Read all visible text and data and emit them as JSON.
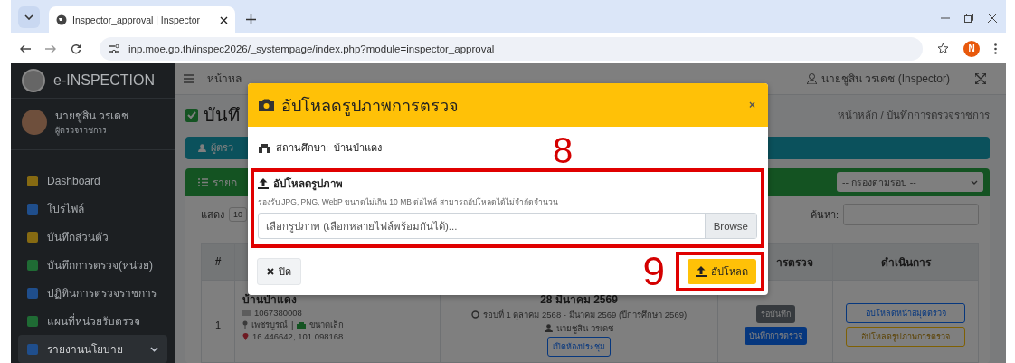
{
  "browser": {
    "tab_title": "Inspector_approval | Inspector",
    "url": "inp.moe.go.th/inspec2026/_systempage/index.php?module=inspector_approval",
    "profile_initial": "N"
  },
  "sidebar": {
    "brand": "e-INSPECTION",
    "user_name": "นายชูสิน วรเดช",
    "user_role": "ผู้ตรวจราชการ",
    "items": [
      {
        "label": "Dashboard",
        "color": "#866a12",
        "kind": "link",
        "selected": false
      },
      {
        "label": "โปรไฟล์",
        "color": "#1f4e8c",
        "kind": "link",
        "selected": false
      },
      {
        "label": "บันทึกส่วนตัว",
        "color": "#866a12",
        "kind": "link",
        "selected": false
      },
      {
        "label": "บันทึกการตรวจ(หน่วย)",
        "color": "#1f6b34",
        "kind": "link",
        "selected": false
      },
      {
        "label": "ปฏิทินการตรวจราชการ",
        "color": "#1f4e8c",
        "kind": "link",
        "selected": false
      },
      {
        "label": "แผนที่หน่วยรับตรวจ",
        "color": "#1f6b34",
        "kind": "link",
        "selected": false
      },
      {
        "label": "รายงานนโยบาย",
        "color": "#1f4e8c",
        "kind": "group",
        "selected": true
      }
    ]
  },
  "topbar": {
    "home": "หน้าหล",
    "user": "นายชูสิน วรเดช (Inspector)"
  },
  "page": {
    "title": "บันทึ",
    "breadcrumb_home": "หน้าหลัก",
    "breadcrumb_separator": "/",
    "breadcrumb_current": "บันทึกการตรวจราชการ",
    "info_bar": "ผู้ตรว",
    "list_header": "รายก",
    "filter": "-- กรองตามรอบ --",
    "show_label": "แสดง",
    "page_size": "10",
    "search_label": "ค้นหา:"
  },
  "table": {
    "columns": [
      "#",
      "ารตรวจ",
      "ดำเนินการ"
    ],
    "rows": [
      {
        "number": "1",
        "school": "บ้านป่าแดง",
        "school_code": "1067380008",
        "province": "เพชรบูรณ์",
        "separator": "|",
        "size": "ขนาดเล็ก",
        "coordinates": "16.446642, 101.098168",
        "date": "28 มีนาคม 2569",
        "round": "รอบที่ 1 ตุลาคม 2568 - มีนาคม 2569 (ปีการศึกษา 2569)",
        "inspector": "นายชูสิน วรเดช",
        "meeting_button": "เปิดห้องประชุม",
        "status": "รอบันทึก",
        "record_button": "บันทึกการตรวจ",
        "upload_book_button": "อัปโหลดหน้าสมุดตรวจ",
        "upload_photo_button": "อัปโหลดรูปภาพการตรวจ"
      }
    ]
  },
  "modal": {
    "title": "อัปโหลดรูปภาพการตรวจ",
    "close": "×",
    "school_label": "สถานศึกษา:",
    "school_value": "บ้านป่าแดง",
    "upload_label": "อัปโหลดรูปภาพ",
    "hint": "รองรับ JPG, PNG, WebP ขนาดไม่เกิน 10 MB ต่อไฟล์ สามารถอัปโหลดได้ไม่จำกัดจำนวน",
    "file_placeholder": "เลือกรูปภาพ (เลือกหลายไฟล์พร้อมกันได้)...",
    "browse": "Browse",
    "close_button": "ปิด",
    "upload_button": "อัปโหลด",
    "annotations": [
      {
        "label": "8"
      },
      {
        "label": "9"
      }
    ]
  }
}
